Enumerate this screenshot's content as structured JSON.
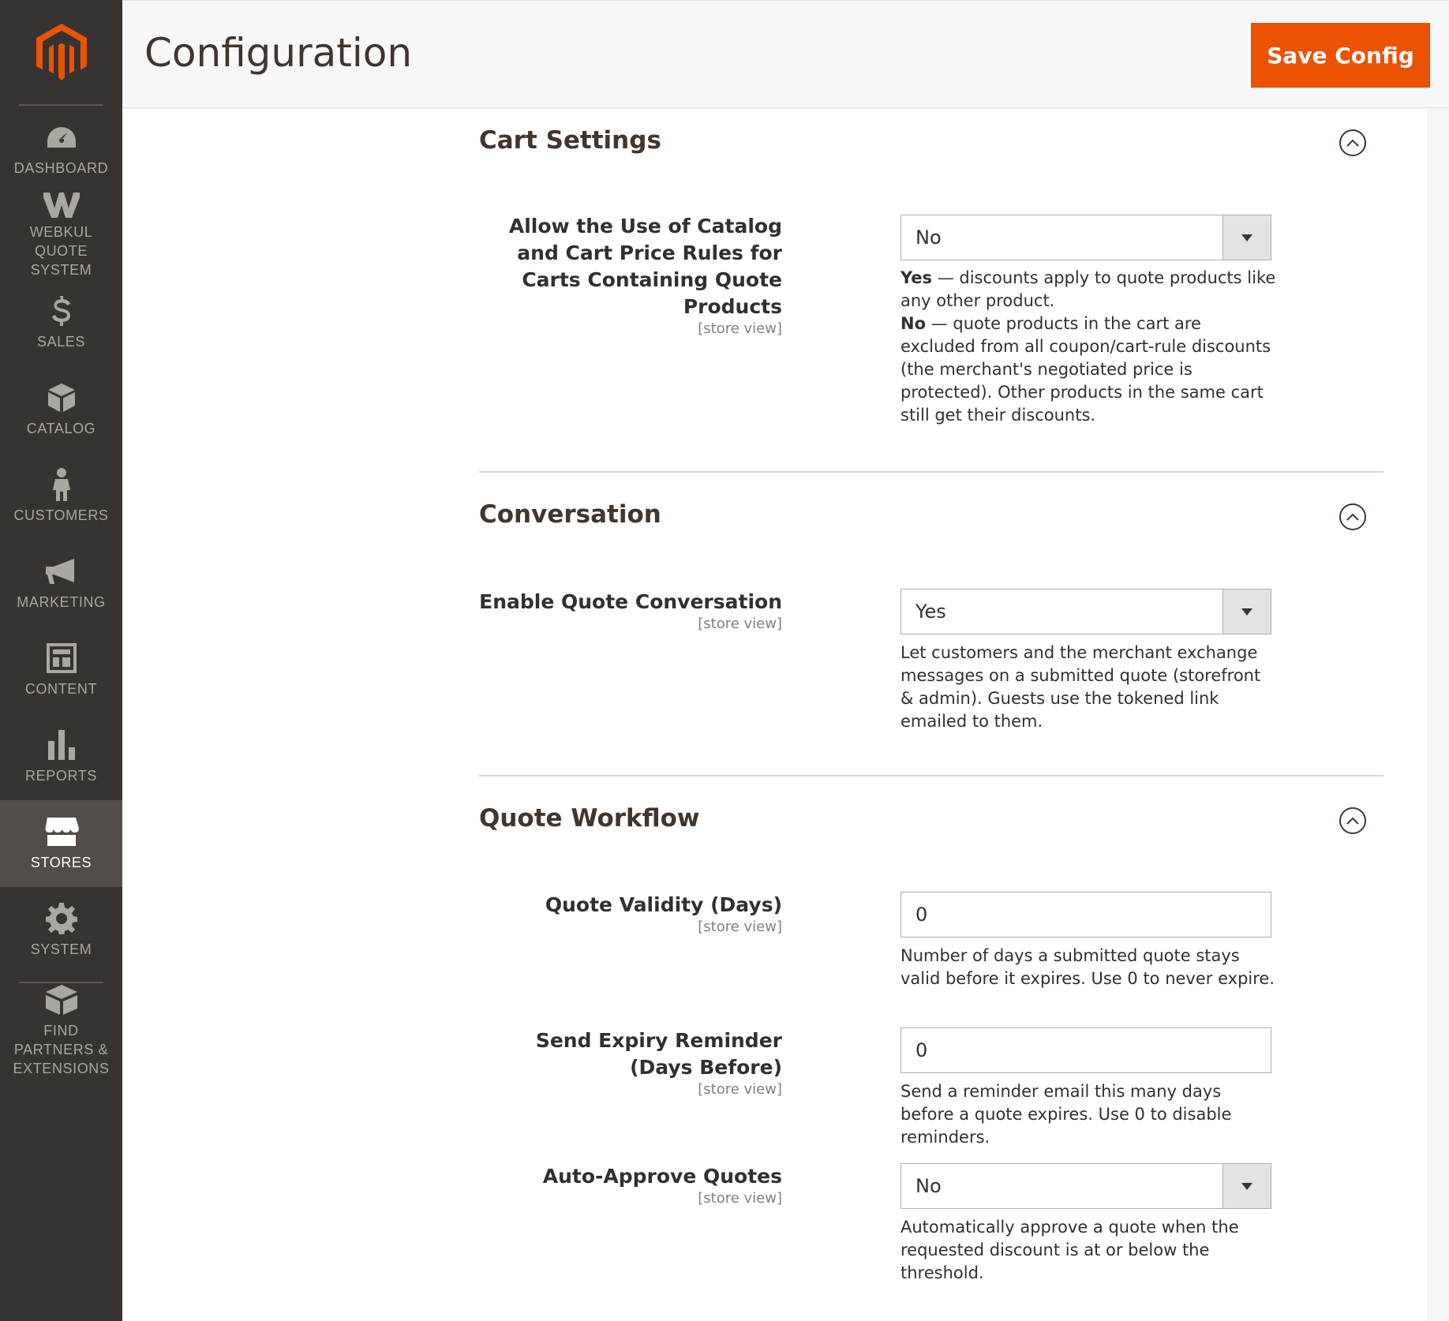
{
  "brand": {
    "accent_color": "#eb5202",
    "sidebar_color": "#373330",
    "logo_icon": "magento-logo-icon"
  },
  "header": {
    "title": "Configuration",
    "save_label": "Save Config"
  },
  "sidebar": {
    "items": [
      {
        "label": "DASHBOARD",
        "icon": "speedometer-icon",
        "active": false
      },
      {
        "label": "WEBKUL QUOTE SYSTEM",
        "icon": "webkul-icon",
        "active": false
      },
      {
        "label": "SALES",
        "icon": "dollar-icon",
        "active": false
      },
      {
        "label": "CATALOG",
        "icon": "box-icon",
        "active": false
      },
      {
        "label": "CUSTOMERS",
        "icon": "person-icon",
        "active": false
      },
      {
        "label": "MARKETING",
        "icon": "megaphone-icon",
        "active": false
      },
      {
        "label": "CONTENT",
        "icon": "layout-icon",
        "active": false
      },
      {
        "label": "REPORTS",
        "icon": "bar-chart-icon",
        "active": false
      },
      {
        "label": "STORES",
        "icon": "storefront-icon",
        "active": true
      },
      {
        "label": "SYSTEM",
        "icon": "gear-icon",
        "active": false
      },
      {
        "label": "FIND PARTNERS & EXTENSIONS",
        "icon": "blocks-icon",
        "active": false
      }
    ]
  },
  "sections": {
    "cart": {
      "title": "Cart Settings",
      "fields": {
        "catalog_rules": {
          "label": "Allow the Use of Catalog and Cart Price Rules for Carts Containing Quote Products",
          "scope": "[store view]",
          "value": "No",
          "note_yes_term": "Yes",
          "note_yes_text": " — discounts apply to quote products like any other product.",
          "note_no_term": "No",
          "note_no_text": " — quote products in the cart are excluded from all coupon/cart-rule discounts (the merchant's negotiated price is protected). Other products in the same cart still get their discounts."
        }
      }
    },
    "conversation": {
      "title": "Conversation",
      "fields": {
        "enable": {
          "label": "Enable Quote Conversation",
          "scope": "[store view]",
          "value": "Yes",
          "note": "Let customers and the merchant exchange messages on a submitted quote (storefront & admin). Guests use the tokened link emailed to them."
        }
      }
    },
    "workflow": {
      "title": "Quote Workflow",
      "fields": {
        "validity": {
          "label": "Quote Validity (Days)",
          "scope": "[store view]",
          "value": "0",
          "note": "Number of days a submitted quote stays valid before it expires. Use 0 to never expire."
        },
        "reminder": {
          "label": "Send Expiry Reminder (Days Before)",
          "scope": "[store view]",
          "value": "0",
          "note": "Send a reminder email this many days before a quote expires. Use 0 to disable reminders."
        },
        "auto_approve": {
          "label": "Auto-Approve Quotes",
          "scope": "[store view]",
          "value": "No",
          "note": "Automatically approve a quote when the requested discount is at or below the threshold."
        }
      }
    }
  }
}
